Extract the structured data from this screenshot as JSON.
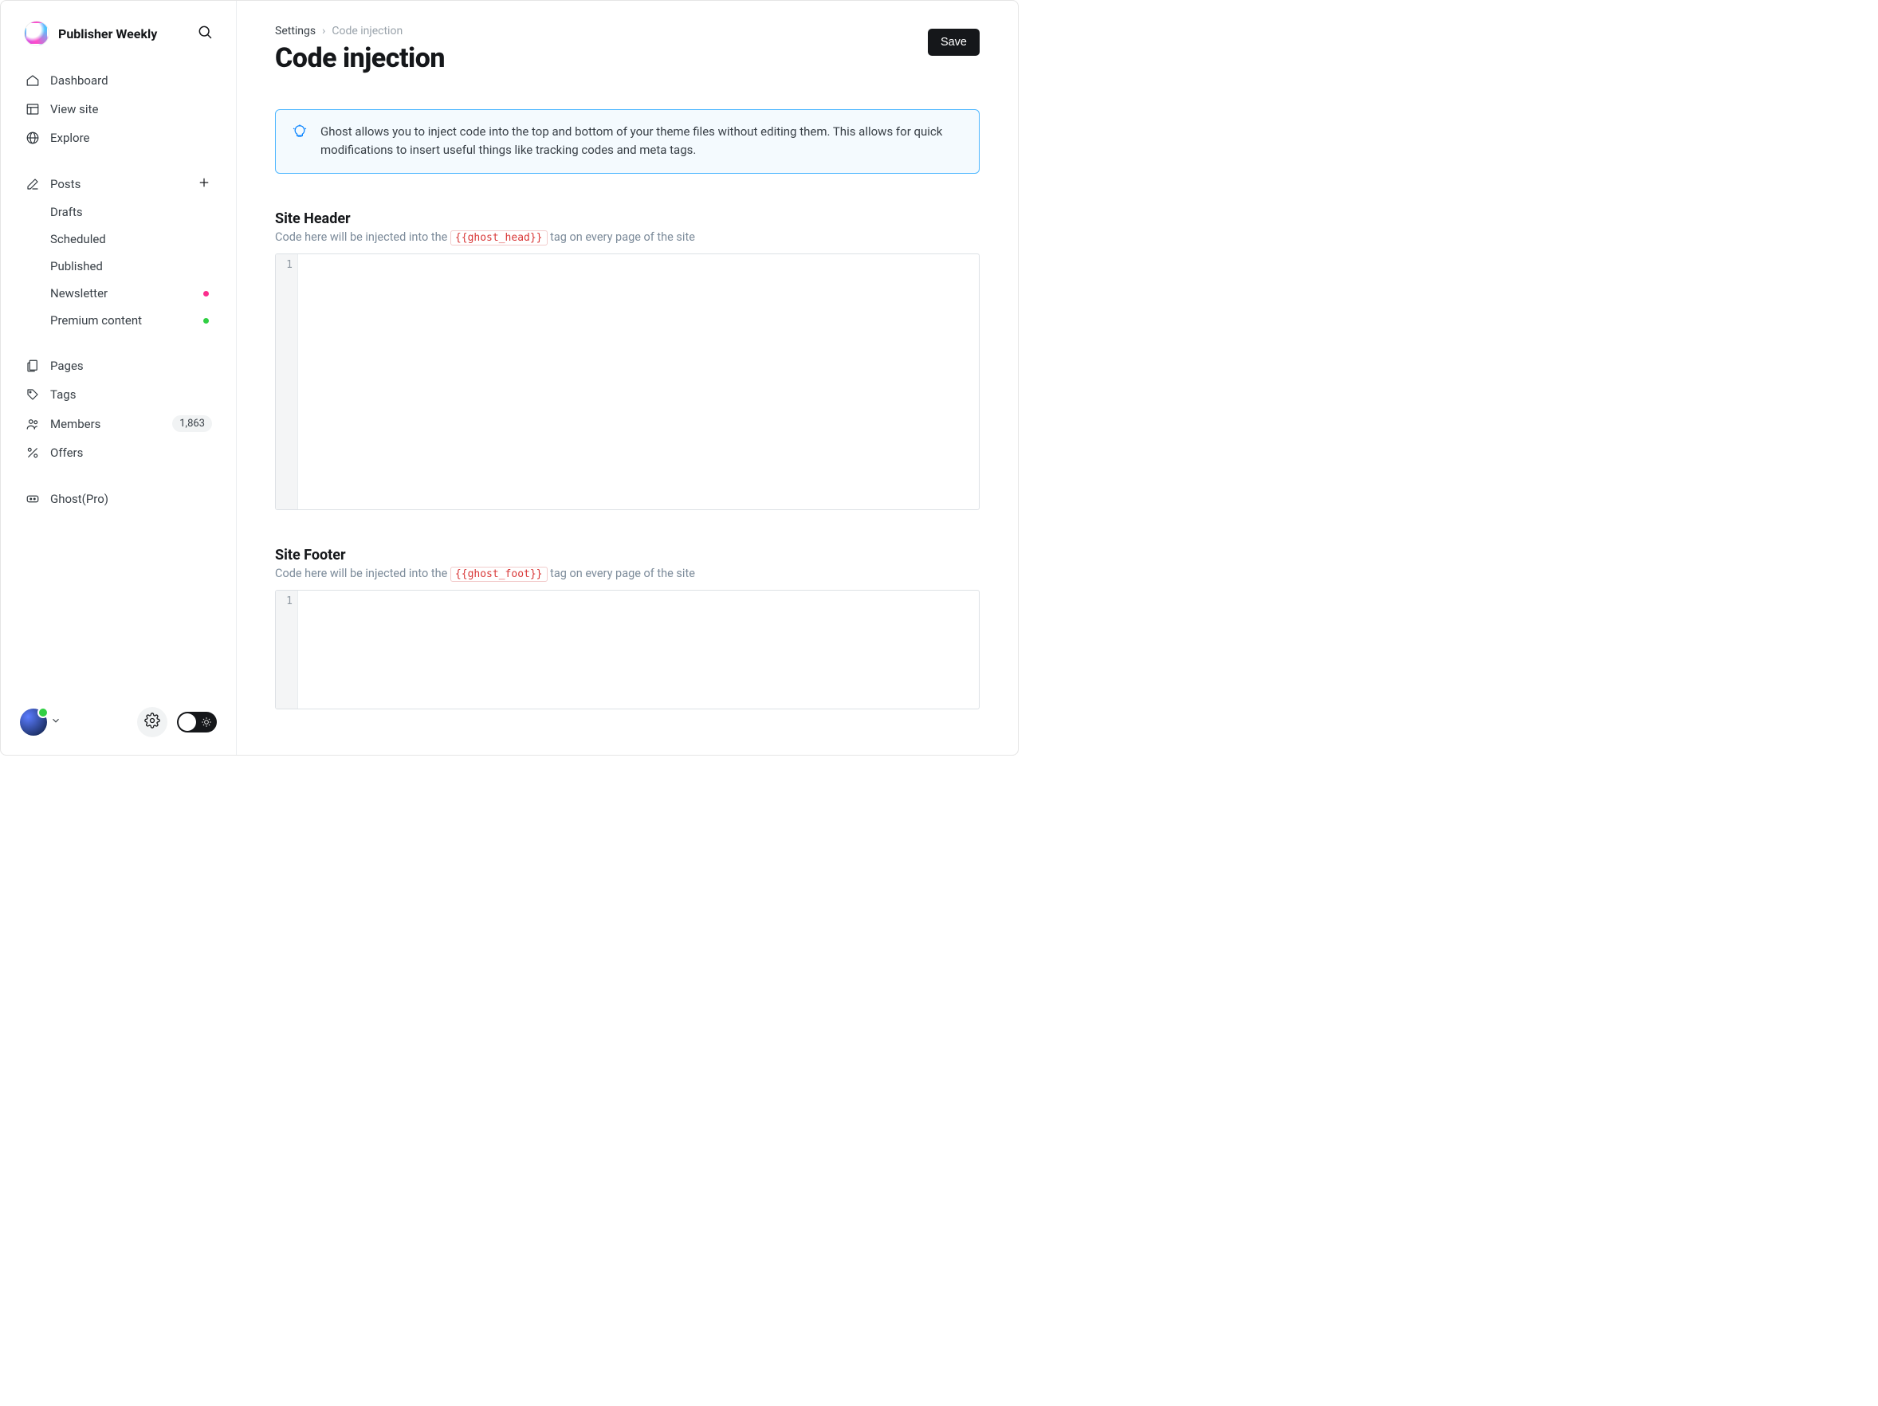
{
  "sidebar": {
    "site_title": "Publisher Weekly",
    "nav": {
      "dashboard": "Dashboard",
      "view_site": "View site",
      "explore": "Explore",
      "posts": "Posts",
      "drafts": "Drafts",
      "scheduled": "Scheduled",
      "published": "Published",
      "newsletter": "Newsletter",
      "premium": "Premium content",
      "pages": "Pages",
      "tags": "Tags",
      "members": "Members",
      "members_count": "1,863",
      "offers": "Offers",
      "ghostpro": "Ghost(Pro)"
    }
  },
  "breadcrumb": {
    "root": "Settings",
    "current": "Code injection"
  },
  "page": {
    "title": "Code injection",
    "save_label": "Save",
    "info_text": "Ghost allows you to inject code into the top and bottom of your theme files without editing them. This allows for quick modifications to insert useful things like tracking codes and meta tags."
  },
  "sections": {
    "head": {
      "title": "Site Header",
      "desc_pre": "Code here will be injected into the ",
      "tag": "{{ghost_head}}",
      "desc_post": " tag on every page of the site",
      "gutter": "1",
      "value": ""
    },
    "foot": {
      "title": "Site Footer",
      "desc_pre": "Code here will be injected into the ",
      "tag": "{{ghost_foot}}",
      "desc_post": " tag on every page of the site",
      "gutter": "1",
      "value": ""
    }
  }
}
